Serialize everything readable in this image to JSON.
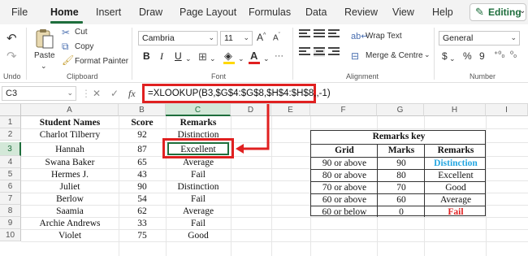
{
  "menu": {
    "items": [
      "File",
      "Home",
      "Insert",
      "Draw",
      "Page Layout",
      "Formulas",
      "Data",
      "Review",
      "View",
      "Help"
    ],
    "active": "Home",
    "editing_label": "Editing"
  },
  "ribbon": {
    "undo_label": "Undo",
    "clipboard": {
      "paste": "Paste",
      "cut": "Cut",
      "copy": "Copy",
      "format_painter": "Format Painter",
      "group": "Clipboard"
    },
    "font": {
      "name": "Cambria",
      "size": "11",
      "bold": "B",
      "italic": "I",
      "underline": "U",
      "group": "Font"
    },
    "alignment": {
      "wrap_text": "Wrap Text",
      "merge": "Merge & Centre",
      "group": "Alignment"
    },
    "number": {
      "format": "General",
      "currency": "$",
      "percent": "%",
      "comma": "9",
      "group": "Number"
    }
  },
  "formula_bar": {
    "name_box": "C3",
    "fx": "fx",
    "formula": "=XLOOKUP(B3,$G$4:$G$8,$H$4:$H$8,,-1)"
  },
  "grid": {
    "columns": [
      "A",
      "B",
      "C",
      "D",
      "E",
      "F",
      "G",
      "H",
      "I"
    ],
    "rows": [
      "1",
      "2",
      "3",
      "4",
      "5",
      "6",
      "7",
      "8",
      "9",
      "10"
    ],
    "headers": {
      "name": "Student Names",
      "score": "Score",
      "remarks": "Remarks"
    },
    "students": [
      {
        "name": "Charlot Tilberry",
        "score": "92",
        "remark": "Distinction"
      },
      {
        "name": "Hannah",
        "score": "87",
        "remark": "Excellent"
      },
      {
        "name": "Swana Baker",
        "score": "65",
        "remark": "Average"
      },
      {
        "name": "Hermes J.",
        "score": "43",
        "remark": "Fail"
      },
      {
        "name": "Juliet",
        "score": "90",
        "remark": "Distinction"
      },
      {
        "name": "Berlow",
        "score": "54",
        "remark": "Fail"
      },
      {
        "name": "Saamia",
        "score": "62",
        "remark": "Average"
      },
      {
        "name": "Archie Andrews",
        "score": "33",
        "remark": "Fail"
      },
      {
        "name": "Violet",
        "score": "75",
        "remark": "Good"
      }
    ]
  },
  "remarks_key": {
    "title": "Remarks key",
    "headers": [
      "Grid",
      "Marks",
      "Remarks"
    ],
    "rows": [
      {
        "grid": "90 or above",
        "marks": "90",
        "remark": "Distinction"
      },
      {
        "grid": "80 or above",
        "marks": "80",
        "remark": "Excellent"
      },
      {
        "grid": "70 or above",
        "marks": "70",
        "remark": "Good"
      },
      {
        "grid": "60 or above",
        "marks": "60",
        "remark": "Average"
      },
      {
        "grid": "60 or below",
        "marks": "0",
        "remark": "Fail"
      }
    ]
  },
  "colors": {
    "accent": "#1e6e3c",
    "highlight_red": "#e02020",
    "distinction_blue": "#22a5e0",
    "fail_red": "#e02020"
  }
}
